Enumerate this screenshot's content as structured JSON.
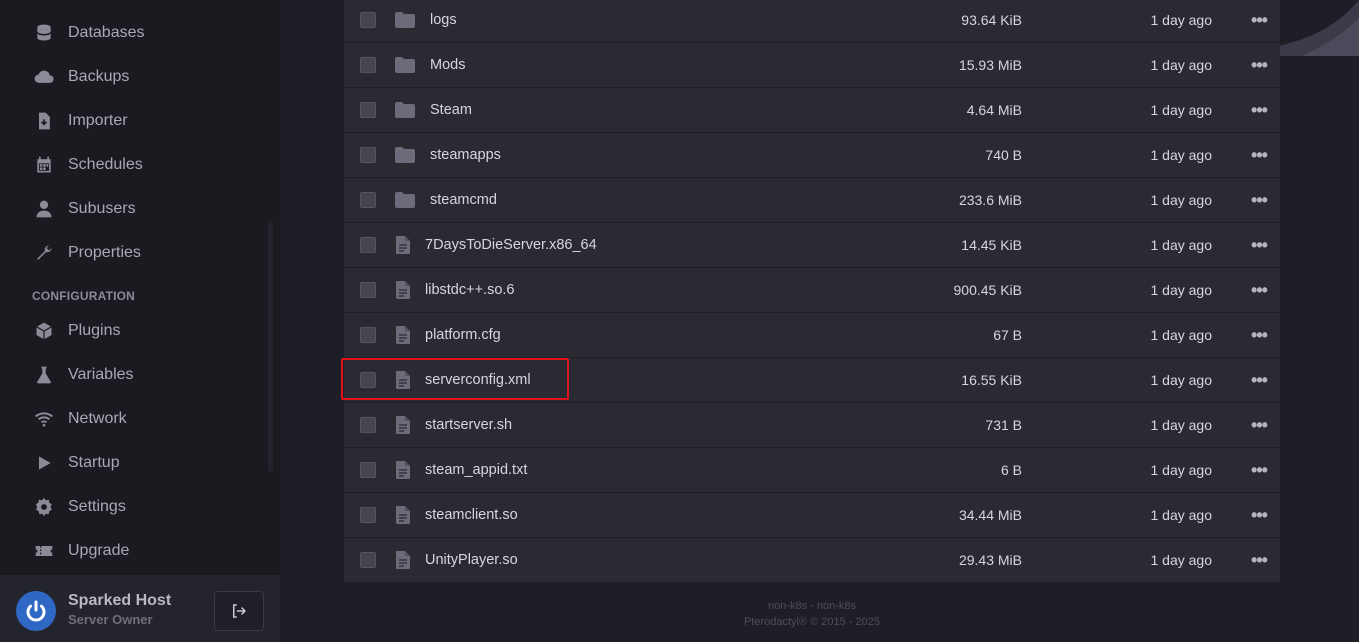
{
  "sidebar": {
    "items_top": [
      {
        "label": "Databases",
        "icon": "database-icon"
      },
      {
        "label": "Backups",
        "icon": "cloud-icon"
      },
      {
        "label": "Importer",
        "icon": "file-import-icon"
      },
      {
        "label": "Schedules",
        "icon": "calendar-icon"
      },
      {
        "label": "Subusers",
        "icon": "user-icon"
      },
      {
        "label": "Properties",
        "icon": "wrench-icon"
      }
    ],
    "section_label": "CONFIGURATION",
    "items_config": [
      {
        "label": "Plugins",
        "icon": "cube-icon"
      },
      {
        "label": "Variables",
        "icon": "flask-icon"
      },
      {
        "label": "Network",
        "icon": "wifi-icon"
      },
      {
        "label": "Startup",
        "icon": "play-icon"
      },
      {
        "label": "Settings",
        "icon": "gear-icon"
      },
      {
        "label": "Upgrade",
        "icon": "ticket-icon"
      }
    ]
  },
  "user": {
    "name": "Sparked Host",
    "role": "Server Owner"
  },
  "files": [
    {
      "name": "logs",
      "type": "folder",
      "size": "93.64 KiB",
      "modified": "1 day ago"
    },
    {
      "name": "Mods",
      "type": "folder",
      "size": "15.93 MiB",
      "modified": "1 day ago"
    },
    {
      "name": "Steam",
      "type": "folder",
      "size": "4.64 MiB",
      "modified": "1 day ago"
    },
    {
      "name": "steamapps",
      "type": "folder",
      "size": "740 B",
      "modified": "1 day ago"
    },
    {
      "name": "steamcmd",
      "type": "folder",
      "size": "233.6 MiB",
      "modified": "1 day ago"
    },
    {
      "name": "7DaysToDieServer.x86_64",
      "type": "file",
      "size": "14.45 KiB",
      "modified": "1 day ago"
    },
    {
      "name": "libstdc++.so.6",
      "type": "file",
      "size": "900.45 KiB",
      "modified": "1 day ago"
    },
    {
      "name": "platform.cfg",
      "type": "file",
      "size": "67 B",
      "modified": "1 day ago"
    },
    {
      "name": "serverconfig.xml",
      "type": "file",
      "size": "16.55 KiB",
      "modified": "1 day ago"
    },
    {
      "name": "startserver.sh",
      "type": "file",
      "size": "731 B",
      "modified": "1 day ago"
    },
    {
      "name": "steam_appid.txt",
      "type": "file",
      "size": "6 B",
      "modified": "1 day ago"
    },
    {
      "name": "steamclient.so",
      "type": "file",
      "size": "34.44 MiB",
      "modified": "1 day ago"
    },
    {
      "name": "UnityPlayer.so",
      "type": "file",
      "size": "29.43 MiB",
      "modified": "1 day ago"
    }
  ],
  "menu_glyph": "•••",
  "footer": {
    "line1": "non-k8s - non-k8s",
    "line2": "Pterodactyl® © 2015 - 2025"
  },
  "colors": {
    "highlight": "#e0141c",
    "avatar": "#2f67c4"
  }
}
